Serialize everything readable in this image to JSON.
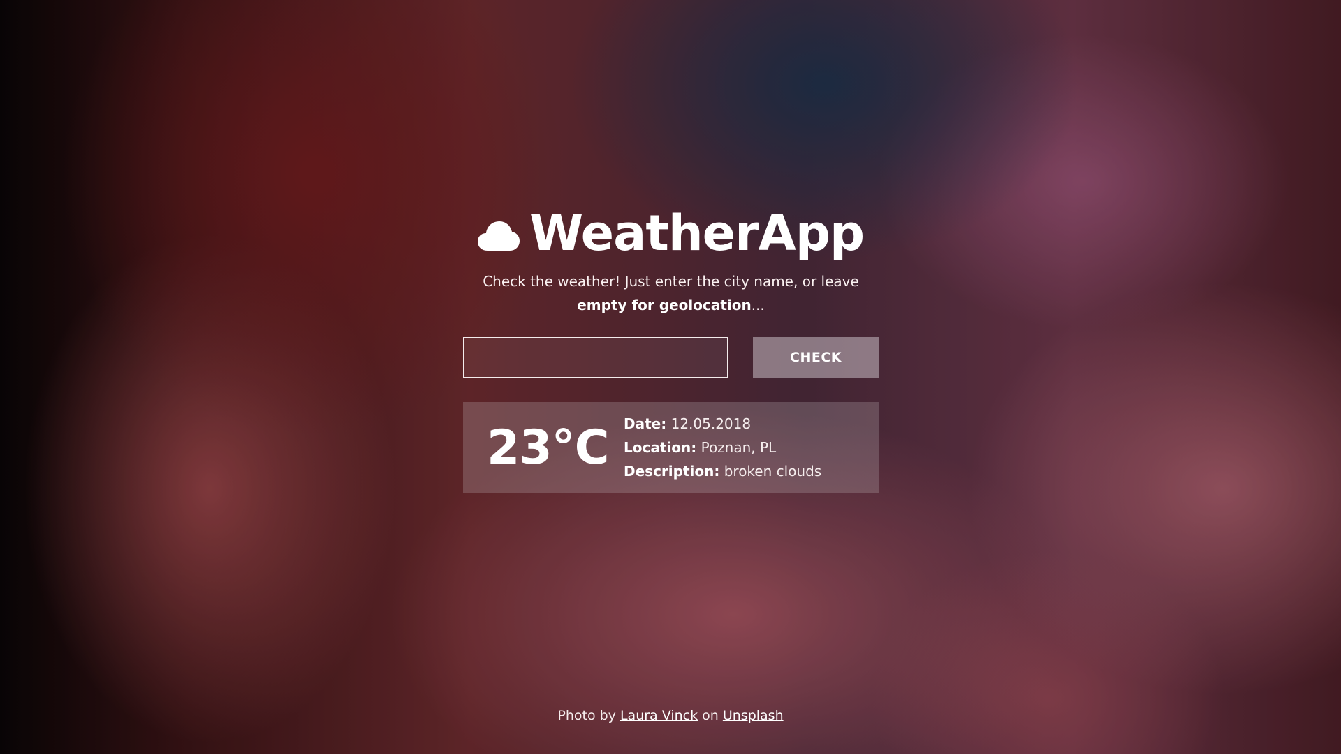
{
  "app": {
    "title": "WeatherApp",
    "icon": "cloud-icon",
    "subtitle_prefix": "Check the weather! Just enter the city name, or leave ",
    "subtitle_bold": "empty for geolocation",
    "subtitle_suffix": "..."
  },
  "form": {
    "city_value": "",
    "city_placeholder": "",
    "check_label": "CHECK"
  },
  "weather": {
    "temperature": "23°C",
    "date_label": "Date:",
    "date_value": "12.05.2018",
    "location_label": "Location:",
    "location_value": "Poznan, PL",
    "description_label": "Description:",
    "description_value": "broken clouds"
  },
  "footer": {
    "prefix": "Photo by ",
    "author": "Laura Vinck",
    "middle": " on ",
    "site": "Unsplash"
  }
}
